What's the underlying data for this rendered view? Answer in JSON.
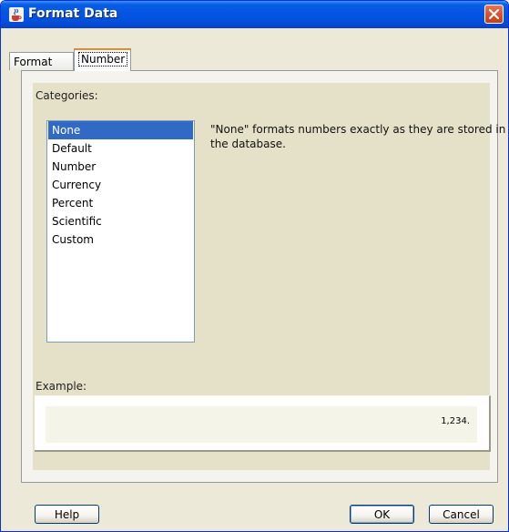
{
  "window": {
    "title": "Format Data",
    "icon": "java-cup-icon"
  },
  "tabs": [
    {
      "label": "Format",
      "active": false
    },
    {
      "label": "Number",
      "active": true
    }
  ],
  "categories": {
    "label": "Categories:",
    "items": [
      "None",
      "Default",
      "Number",
      "Currency",
      "Percent",
      "Scientific",
      "Custom"
    ],
    "selected": "None"
  },
  "description": "\"None\" formats numbers exactly as they are stored in the database.",
  "example": {
    "label": "Example:",
    "value": "1,234."
  },
  "buttons": {
    "help": "Help",
    "ok": "OK",
    "cancel": "Cancel"
  },
  "colors": {
    "titlebar": "#0454e3",
    "selection": "#316ac5",
    "panel_inner": "#e5e1c8",
    "dialog_bg": "#ece9d8"
  }
}
